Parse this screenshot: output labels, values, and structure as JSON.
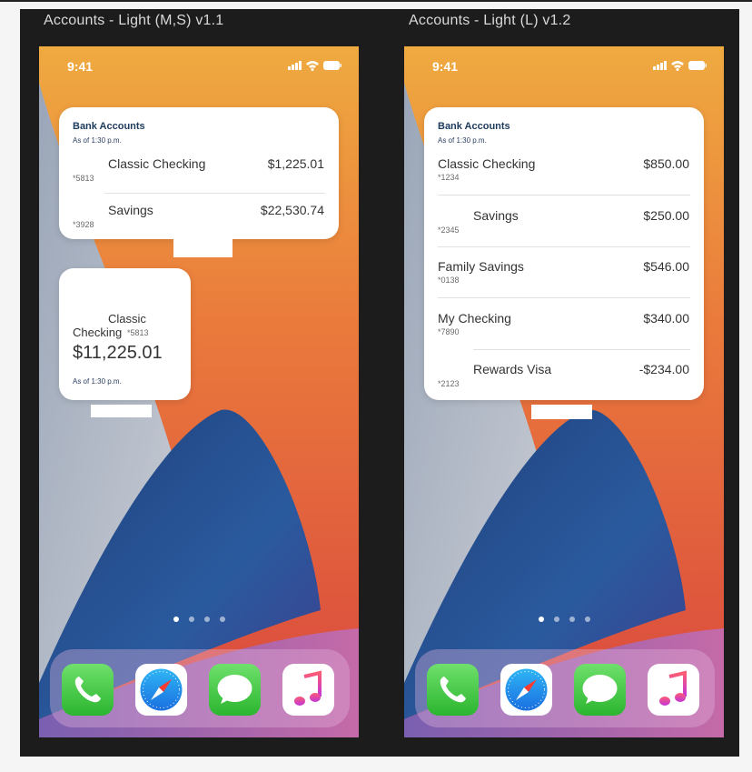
{
  "screens": [
    {
      "title": "Accounts - Light (M,S) v1.1",
      "status_time": "9:41",
      "widget_medium": {
        "title": "Bank Accounts",
        "as_of": "As of 1:30 p.m.",
        "accounts": [
          {
            "name": "Classic Checking",
            "number": "*5813",
            "amount": "$1,225.01"
          },
          {
            "name": "Savings",
            "number": "*3928",
            "amount": "$22,530.74"
          }
        ]
      },
      "widget_small": {
        "name_line1": "Classic",
        "name_line2": "Checking",
        "number": "*5813",
        "amount": "$11,225.01",
        "as_of": "As of 1:30 p.m."
      },
      "page_dots": {
        "count": 4,
        "active": 1
      },
      "dock": [
        "phone-icon",
        "safari-icon",
        "messages-icon",
        "music-icon"
      ]
    },
    {
      "title": "Accounts - Light (L) v1.2",
      "status_time": "9:41",
      "widget_large": {
        "title": "Bank Accounts",
        "as_of": "As of 1:30 p.m.",
        "accounts": [
          {
            "name": "Classic Checking",
            "number": "*1234",
            "amount": "$850.00"
          },
          {
            "name": "Savings",
            "number": "*2345",
            "amount": "$250.00"
          },
          {
            "name": "Family Savings",
            "number": "*0138",
            "amount": "$546.00"
          },
          {
            "name": "My Checking",
            "number": "*7890",
            "amount": "$340.00"
          },
          {
            "name": "Rewards Visa",
            "number": "*2123",
            "amount": "-$234.00"
          }
        ]
      },
      "page_dots": {
        "count": 4,
        "active": 1
      },
      "dock": [
        "phone-icon",
        "safari-icon",
        "messages-icon",
        "music-icon"
      ]
    }
  ],
  "colors": {
    "wallpaper_orange": "#f0a43f",
    "wallpaper_red": "#d2463f",
    "wallpaper_blue": "#20498a",
    "title_navy": "#1d3a5c"
  }
}
